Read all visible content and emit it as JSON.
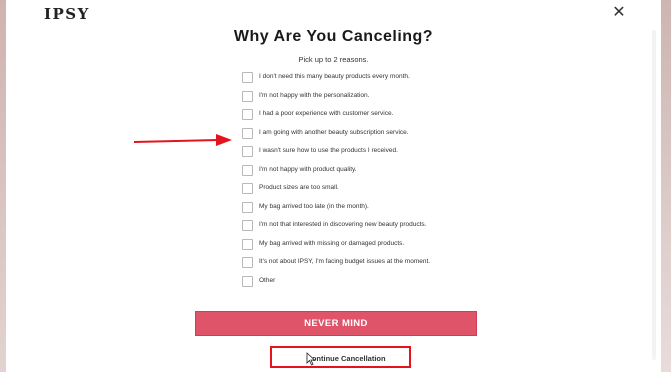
{
  "header": {
    "logo": "IPSY",
    "close_icon": "close-icon"
  },
  "title": "Why Are You Canceling?",
  "subtitle": "Pick up to 2 reasons.",
  "reasons": [
    "I don't need this many beauty products every month.",
    "I'm not happy with the personalization.",
    "I had a poor experience with customer service.",
    "I am going with another beauty subscription service.",
    "I wasn't sure how to use the products I received.",
    "I'm not happy with product quality.",
    "Product sizes are too small.",
    "My bag arrived too late (in the month).",
    "I'm not that interested in discovering new beauty products.",
    "My bag arrived with missing or damaged products.",
    "It's not about IPSY, I'm facing budget issues at the moment.",
    "Other"
  ],
  "buttons": {
    "never_mind": "NEVER MIND",
    "continue_cancellation": "Continue Cancellation"
  },
  "colors": {
    "primary_button": "#e0546a",
    "annotation": "#e5141c"
  }
}
